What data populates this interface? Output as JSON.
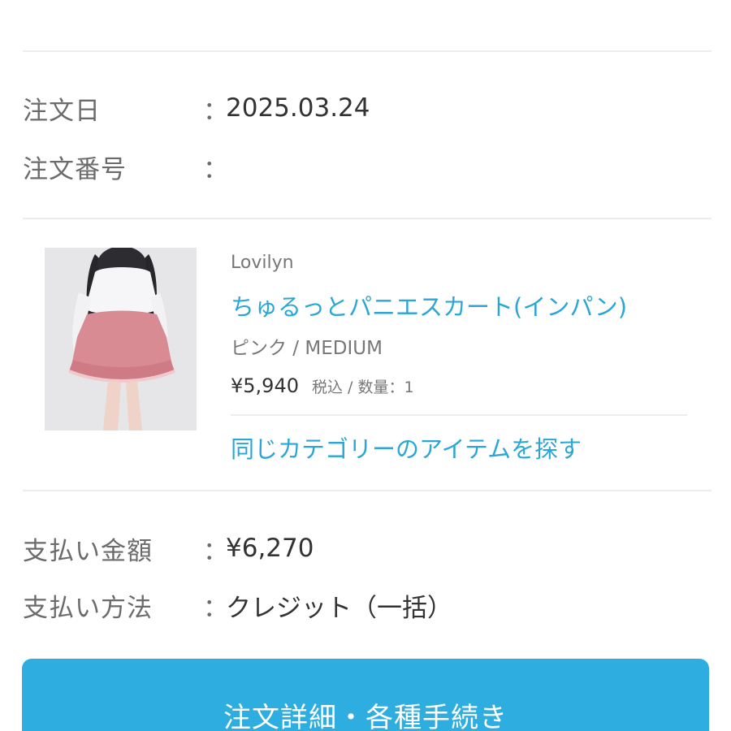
{
  "order": {
    "date_label": "注文日",
    "date_value": "2025.03.24",
    "number_label": "注文番号",
    "number_value": "",
    "colon": "："
  },
  "product": {
    "brand": "Lovilyn",
    "name": "ちゅるっとパニエスカート(インパン)",
    "variant": "ピンク / MEDIUM",
    "price": "¥5,940",
    "price_meta": "税込 / 数量：1",
    "related_link": "同じカテゴリーのアイテムを探す"
  },
  "payment": {
    "amount_label": "支払い金額",
    "amount_value": "¥6,270",
    "method_label": "支払い方法",
    "method_value": "クレジット（一括）"
  },
  "actions": {
    "details_button_label": "注文詳細・各種手続き"
  },
  "colors": {
    "accent_link": "#2aa7d6",
    "button_bg": "#2eaee0",
    "skirt_pink": "#d98b94"
  }
}
